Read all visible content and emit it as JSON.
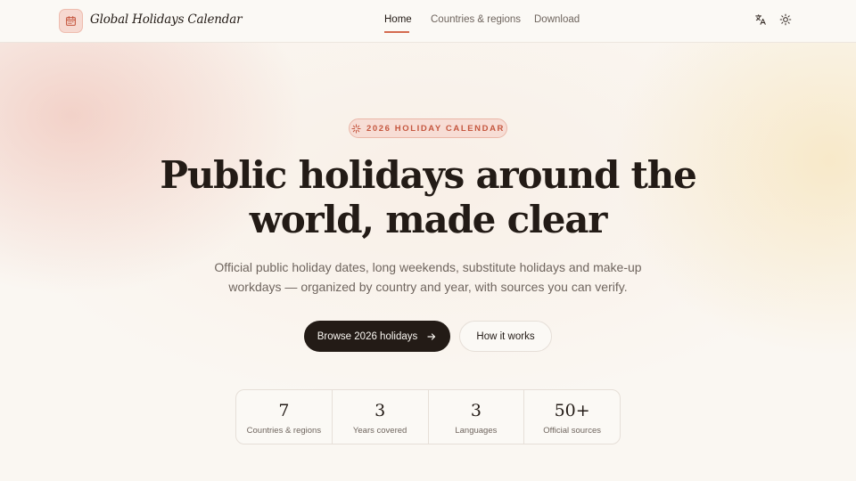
{
  "header": {
    "brand": "Global Holidays Calendar",
    "brand_icon": "calendar-icon",
    "nav": [
      {
        "label": "Home",
        "active": true
      },
      {
        "label": "Countries & regions",
        "active": false
      },
      {
        "label": "Download",
        "active": false
      }
    ],
    "actions": [
      "translate-icon",
      "sun-icon"
    ]
  },
  "hero": {
    "badge": "2026 HOLIDAY CALENDAR",
    "title_line1": "Public holidays around the",
    "title_line2": "world, made clear",
    "subtitle_line1": "Official public holiday dates, long weekends, substitute holidays and make-up",
    "subtitle_line2": "workdays — organized by country and year, with sources you can verify.",
    "primary_button": "Browse 2026 holidays",
    "secondary_button": "How it works"
  },
  "stats": [
    {
      "value": "7",
      "label": "Countries & regions"
    },
    {
      "value": "3",
      "label": "Years covered"
    },
    {
      "value": "3",
      "label": "Languages"
    },
    {
      "value": "50+",
      "label": "Official sources"
    }
  ],
  "colors": {
    "accent": "#d46a4f",
    "dark": "#231b16",
    "muted": "#6f655e",
    "background": "#faf7f2"
  }
}
